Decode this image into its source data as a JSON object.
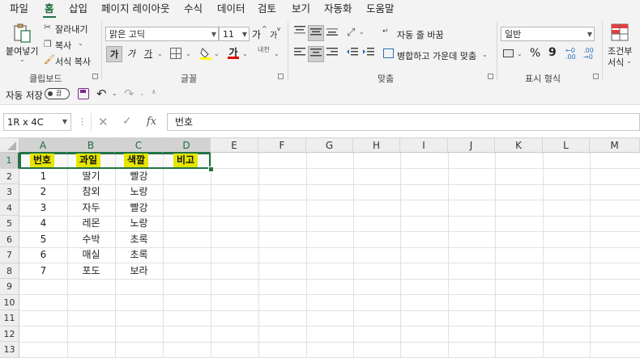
{
  "menu": {
    "tabs": [
      "파일",
      "홈",
      "삽입",
      "페이지 레이아웃",
      "수식",
      "데이터",
      "검토",
      "보기",
      "자동화",
      "도움말"
    ],
    "active_tab": "홈"
  },
  "ribbon": {
    "clipboard": {
      "paste": "붙여넣기",
      "cut": "잘라내기",
      "copy": "복사",
      "format_painter": "서식 복사",
      "label": "클립보드"
    },
    "font": {
      "font_name": "맑은 고딕",
      "font_size": "11",
      "grow": "가",
      "shrink": "가",
      "bold": "가",
      "italic": "가",
      "underline": "가",
      "font_color_glyph": "가",
      "phonetic": "내천",
      "label": "글꼴"
    },
    "alignment": {
      "wrap_text": "자동 줄 바꿈",
      "merge_center": "병합하고 가운데 맞춤",
      "label": "맞춤"
    },
    "number": {
      "format": "일반",
      "percent": "%",
      "comma": "9",
      "label": "표시 형식"
    },
    "styles": {
      "conditional": "조건부",
      "conditional2": "서식"
    }
  },
  "qat": {
    "autosave_label": "자동 저장",
    "autosave_state": "끔"
  },
  "formula_bar": {
    "name_box": "1R x 4C",
    "fx": "fx",
    "content": "번호"
  },
  "grid": {
    "columns": [
      "A",
      "B",
      "C",
      "D",
      "E",
      "F",
      "G",
      "H",
      "I",
      "J",
      "K",
      "L",
      "M"
    ],
    "rows": [
      "1",
      "2",
      "3",
      "4",
      "5",
      "6",
      "7",
      "8",
      "9",
      "10",
      "11",
      "12",
      "13"
    ],
    "header_row": [
      "번호",
      "과일",
      "색깔",
      "비고"
    ],
    "data": [
      [
        "1",
        "딸기",
        "빨강"
      ],
      [
        "2",
        "참외",
        "노랑"
      ],
      [
        "3",
        "자두",
        "빨강"
      ],
      [
        "4",
        "레몬",
        "노랑"
      ],
      [
        "5",
        "수박",
        "초록"
      ],
      [
        "6",
        "매실",
        "초록"
      ],
      [
        "7",
        "포도",
        "보라"
      ]
    ]
  },
  "colors": {
    "accent": "#217346",
    "highlight": "#e6e600"
  }
}
